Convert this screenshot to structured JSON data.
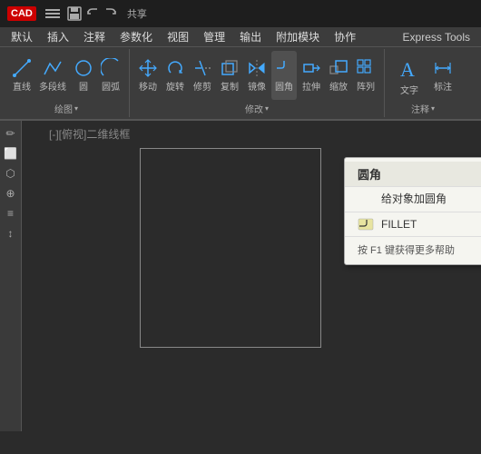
{
  "titlebar": {
    "logo": "CAD",
    "share_label": "共享"
  },
  "menubar": {
    "items": [
      "默认",
      "插入",
      "注释",
      "参数化",
      "视图",
      "管理",
      "输出",
      "附加模块",
      "协作"
    ]
  },
  "ribbon": {
    "express_tools": "Express Tools",
    "groups": {
      "draw": {
        "label": "绘图",
        "tools": [
          "直线",
          "多段线",
          "圆",
          "圆弧"
        ]
      },
      "modify": {
        "label": "修改",
        "tools": [
          "移动",
          "旋转",
          "修剪",
          "复制",
          "镜像",
          "圆角",
          "拉伸",
          "缩放",
          "阵列"
        ]
      },
      "annotation": {
        "label": "注释",
        "tools": [
          "文字",
          "标注"
        ]
      }
    }
  },
  "viewport": {
    "label": "[-][俯视]二维线框"
  },
  "context_popup": {
    "header": "圆角",
    "items": [
      {
        "label": "给对象加圆角",
        "icon": ""
      },
      {
        "label": "FILLET",
        "icon": "fillet",
        "has_icon": true
      }
    ],
    "footer": "按 F1 键获得更多帮助"
  },
  "toolbar": {
    "draw_label": "绘图",
    "modify_label": "修改",
    "annotation_label": "注释"
  },
  "left_toolbar": {
    "tools": [
      "✏",
      "⬜",
      "⬡",
      "⊕",
      "≡",
      "↕"
    ]
  }
}
